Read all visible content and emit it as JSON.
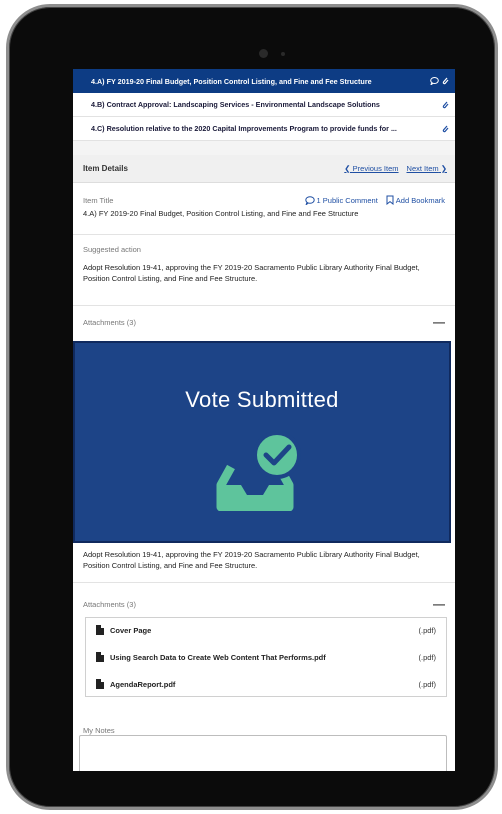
{
  "agenda": {
    "items": [
      {
        "label": "4.A) FY 2019-20 Final Budget, Position Control Listing, and Fine and Fee Structure",
        "active": true,
        "comment": true,
        "attachment": true
      },
      {
        "label": "4.B) Contract Approval: Landscaping Services - Environmental Landscape Solutions",
        "active": false,
        "comment": false,
        "attachment": true
      },
      {
        "label": "4.C) Resolution relative to the 2020 Capital Improvements Program to provide funds for ...",
        "active": false,
        "comment": false,
        "attachment": true
      }
    ]
  },
  "details": {
    "header": "Item Details",
    "previous": "Previous Item",
    "next": "Next Item",
    "item_title_label": "Item Title",
    "public_comment": "1 Public Comment",
    "add_bookmark": "Add Bookmark",
    "item_title": "4.A) FY 2019-20 Final Budget, Position Control Listing, and Fine and Fee Structure",
    "suggested_action_label": "Suggested action",
    "suggested_action": "Adopt Resolution 19-41, approving the FY 2019-20 Sacramento Public Library Authority Final Budget, Position Control Listing, and Fine and Fee Structure.",
    "attachments_label": "Attachments (3)",
    "attachments": [
      {
        "name": "Cover Page",
        "ext": "(.pdf)"
      },
      {
        "name": "Using Search Data to Create Web Content That Performs.pdf",
        "ext": "(.pdf)"
      },
      {
        "name": "AgendaReport.pdf",
        "ext": "(.pdf)"
      }
    ],
    "notes_label": "My Notes"
  },
  "overlay": {
    "title": "Vote Submitted",
    "icon": "inbox-check-icon",
    "bg_color": "#1d4487",
    "icon_color": "#5ec49c"
  }
}
